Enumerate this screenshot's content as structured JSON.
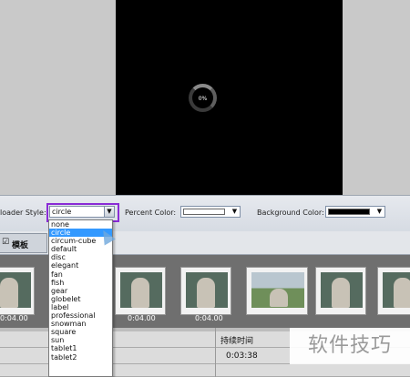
{
  "preview": {
    "percent_text": "0%"
  },
  "options": {
    "loader_style_label": "loader Style:",
    "loader_style_value": "circle",
    "percent_color_label": "Percent Color:",
    "percent_color_value": "#ffffff",
    "background_color_label": "Background Color:",
    "background_color_value": "#000000"
  },
  "tab": {
    "label": "模板",
    "icon": "check-icon"
  },
  "loader_styles": [
    "none",
    "circle",
    "circum-cube",
    "default",
    "disc",
    "elegant",
    "fan",
    "fish",
    "gear",
    "globelet",
    "label",
    "professional",
    "snowman",
    "square",
    "sun",
    "tablet1",
    "tablet2"
  ],
  "selected_style_index": 1,
  "thumbnails": [
    {
      "duration": "0:04.00"
    },
    {
      "duration": ""
    },
    {
      "duration": "0:04.00"
    },
    {
      "duration": "0:04.00"
    },
    {
      "duration": ""
    },
    {
      "duration": ""
    },
    {
      "duration": ""
    }
  ],
  "timeline": {
    "duration_header": "持续时间",
    "total_time": "0:03:38"
  },
  "watermark": "软件技巧"
}
